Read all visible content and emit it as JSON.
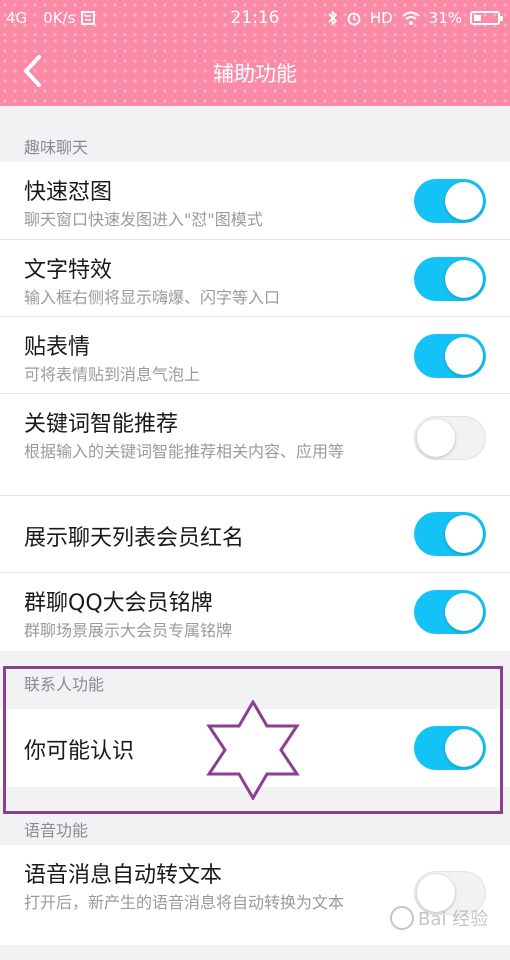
{
  "status_bar": {
    "network": "4G",
    "speed": "0K/s",
    "time": "21:16",
    "hd": "HD",
    "battery": "31%"
  },
  "header": {
    "title": "辅助功能"
  },
  "sections": [
    {
      "title": "趣味聊天",
      "items": [
        {
          "title": "快速怼图",
          "desc": "聊天窗口快速发图进入\"怼\"图模式",
          "enabled": true
        },
        {
          "title": "文字特效",
          "desc": "输入框右侧将显示嗨爆、闪字等入口",
          "enabled": true
        },
        {
          "title": "贴表情",
          "desc": "可将表情贴到消息气泡上",
          "enabled": true
        },
        {
          "title": "关键词智能推荐",
          "desc": "根据输入的关键词智能推荐相关内容、应用等",
          "enabled": false
        },
        {
          "title": "展示聊天列表会员红名",
          "desc": "",
          "enabled": true
        },
        {
          "title": "群聊QQ大会员铭牌",
          "desc": "群聊场景展示大会员专属铭牌",
          "enabled": true
        }
      ]
    },
    {
      "title": "联系人功能",
      "items": [
        {
          "title": "你可能认识",
          "desc": "",
          "enabled": true
        }
      ]
    },
    {
      "title": "语音功能",
      "items": [
        {
          "title": "语音消息自动转文本",
          "desc": "打开后，新产生的语音消息将自动转换为文本",
          "enabled": false
        }
      ]
    }
  ],
  "watermark": "Bai 经验",
  "colors": {
    "header_pink": "#fa8aa6",
    "toggle_on": "#13c3f6",
    "annotation_purple": "#8c3f92"
  }
}
